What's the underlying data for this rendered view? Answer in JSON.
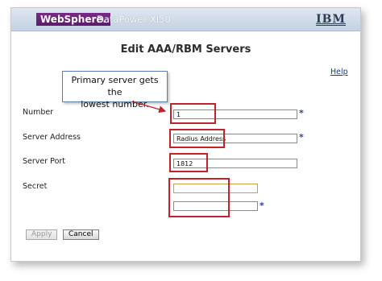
{
  "header": {
    "brand": "WebSphere.",
    "product": "DataPower XI50",
    "vendor_logo": "IBM"
  },
  "page_title": "Edit AAA/RBM Servers",
  "help_link": "Help",
  "callout": {
    "line1": "Primary server gets the",
    "line2": "lowest number."
  },
  "form": {
    "number": {
      "label": "Number",
      "value": "1",
      "required_mark": "*"
    },
    "server_address": {
      "label": "Server Address",
      "value": "Radius Address",
      "required_mark": "*"
    },
    "server_port": {
      "label": "Server Port",
      "value": "1812"
    },
    "secret": {
      "label": "Secret",
      "value": "",
      "confirm_value": "",
      "required_mark": "*"
    }
  },
  "buttons": {
    "apply": "Apply",
    "cancel": "Cancel"
  },
  "colors": {
    "brand_bg": "#6a2277",
    "highlight": "#c0232a",
    "required": "#2b3f9c"
  }
}
